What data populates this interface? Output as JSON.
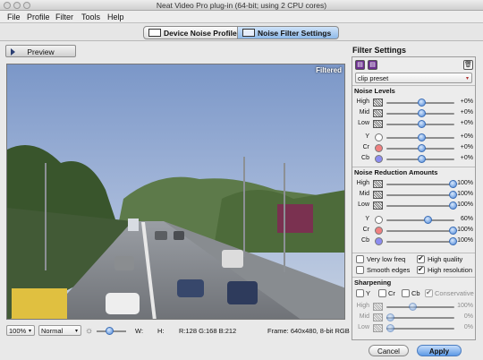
{
  "window": {
    "title": "Neat Video Pro plug-in (64-bit; using 2 CPU cores)"
  },
  "menu": [
    "File",
    "Profile",
    "Filter",
    "Tools",
    "Help"
  ],
  "tabs": [
    {
      "label": "Device Noise Profile",
      "active": false
    },
    {
      "label": "Noise Filter Settings",
      "active": true
    }
  ],
  "preview": {
    "button_label": "Preview",
    "overlay_label": "Filtered"
  },
  "bottom": {
    "zoom": "100%",
    "mode": "Normal",
    "w_label": "W:",
    "h_label": "H:",
    "pixel": "R:128 G:168 B:212",
    "frame_info": "Frame: 640x480, 8-bit RGB"
  },
  "filter": {
    "header": "Filter Settings",
    "preset": "clip preset",
    "noise_levels": {
      "title": "Noise Levels",
      "rows": [
        {
          "label": "High",
          "value": "+0%",
          "level": 0.5
        },
        {
          "label": "Mid",
          "value": "+0%",
          "level": 0.5
        },
        {
          "label": "Low",
          "value": "+0%",
          "level": 0.5
        }
      ],
      "channels": [
        {
          "label": "Y",
          "value": "+0%",
          "level": 0.5
        },
        {
          "label": "Cr",
          "value": "+0%",
          "level": 0.5
        },
        {
          "label": "Cb",
          "value": "+0%",
          "level": 0.5
        }
      ]
    },
    "reduction": {
      "title": "Noise Reduction Amounts",
      "rows": [
        {
          "label": "High",
          "value": "100%",
          "level": 1.0
        },
        {
          "label": "Mid",
          "value": "100%",
          "level": 1.0
        },
        {
          "label": "Low",
          "value": "100%",
          "level": 1.0
        }
      ],
      "channels": [
        {
          "label": "Y",
          "value": "60%",
          "level": 0.6
        },
        {
          "label": "Cr",
          "value": "100%",
          "level": 1.0
        },
        {
          "label": "Cb",
          "value": "100%",
          "level": 1.0
        }
      ]
    },
    "options": {
      "very_low_freq": "Very low freq",
      "high_quality": "High quality",
      "smooth_edges": "Smooth edges",
      "high_resolution": "High resolution"
    },
    "sharpening": {
      "title": "Sharpening",
      "channels": [
        "Y",
        "Cr",
        "Cb"
      ],
      "conservative": "Conservative",
      "rows": [
        {
          "label": "High",
          "value": "100%",
          "level": 0.35
        },
        {
          "label": "Mid",
          "value": "0%",
          "level": 0.0
        },
        {
          "label": "Low",
          "value": "0%",
          "level": 0.0
        }
      ]
    }
  },
  "buttons": {
    "cancel": "Cancel",
    "apply": "Apply"
  },
  "colors": {
    "accent": "#5d9ae6",
    "cr": "#f08080",
    "cb": "#8c8cf0"
  }
}
